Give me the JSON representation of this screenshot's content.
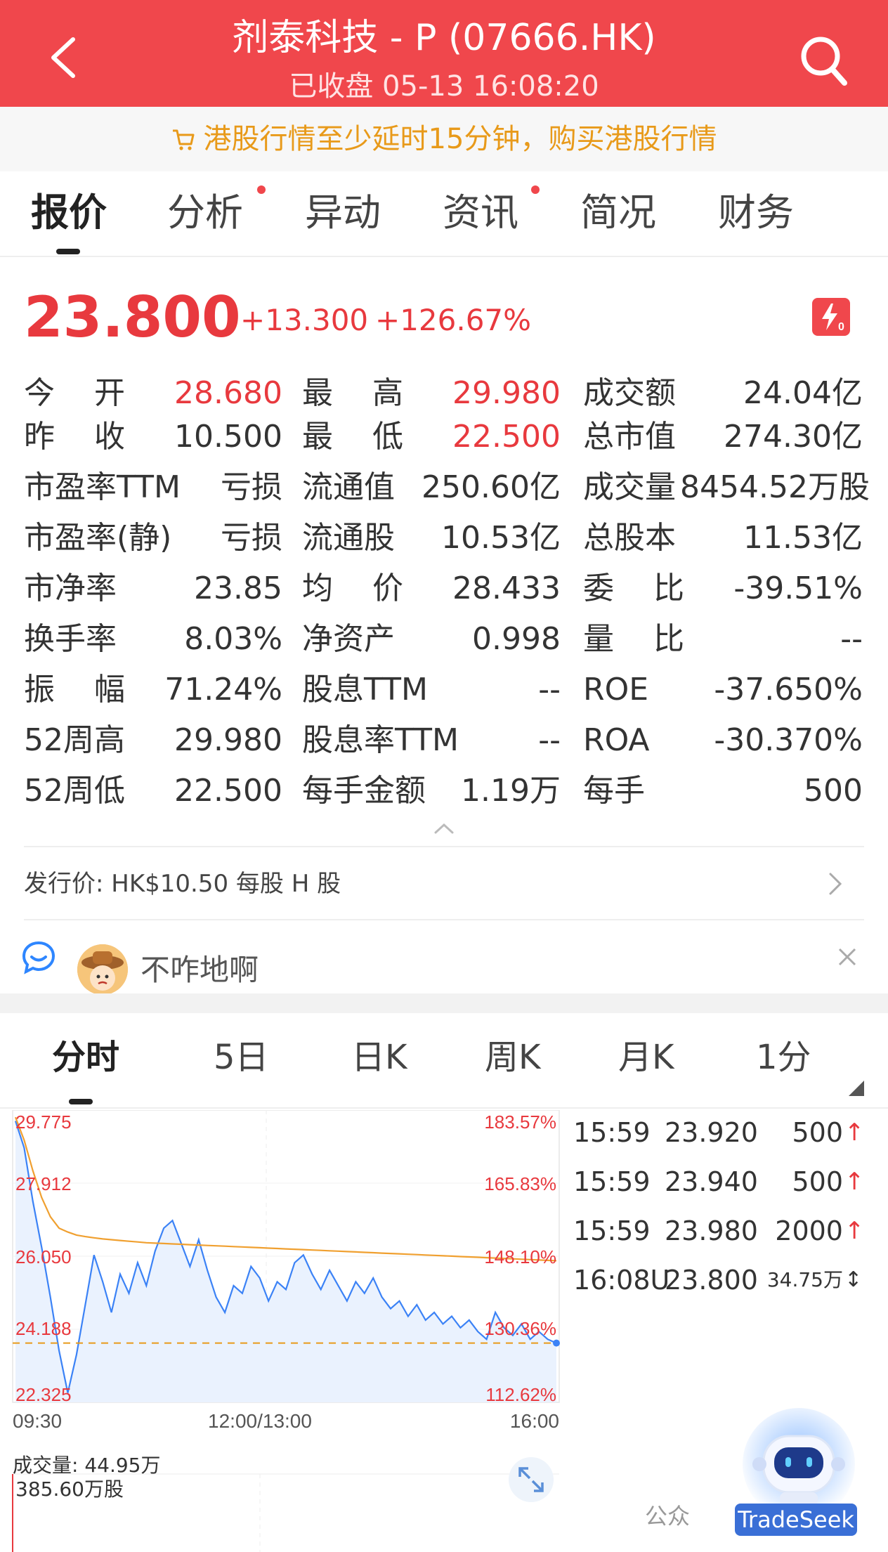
{
  "header": {
    "title": "剂泰科技 - P (07666.HK)",
    "subtitle": "已收盘  05-13  16:08:20",
    "back_icon": "chevron-left-icon",
    "search_icon": "search-icon",
    "bg_color": "#f0474c"
  },
  "notice": {
    "text": "港股行情至少延时15分钟，购买港股行情",
    "icon": "cart-icon",
    "color": "#e89a1a"
  },
  "tabs": [
    {
      "label": "报价",
      "active": true,
      "dot": false
    },
    {
      "label": "分析",
      "active": false,
      "dot": true
    },
    {
      "label": "异动",
      "active": false,
      "dot": false
    },
    {
      "label": "资讯",
      "active": false,
      "dot": true
    },
    {
      "label": "简况",
      "active": false,
      "dot": false
    },
    {
      "label": "财务",
      "active": false,
      "dot": false
    }
  ],
  "quote": {
    "price": "23.800",
    "change": "+13.300",
    "change_pct": "+126.67%",
    "up_color": "#e8393e"
  },
  "stats": {
    "col1": [
      {
        "label": "今    开",
        "value": "28.680",
        "red": true
      },
      {
        "label": "昨    收",
        "value": "10.500",
        "red": false
      },
      {
        "label": "市盈率TTM",
        "value": "亏损",
        "red": false
      },
      {
        "label": "市盈率(静)",
        "value": "亏损",
        "red": false
      },
      {
        "label": "市净率",
        "value": "23.85",
        "red": false
      },
      {
        "label": "换手率",
        "value": "8.03%",
        "red": false
      },
      {
        "label": "振    幅",
        "value": "71.24%",
        "red": false
      },
      {
        "label": "52周高",
        "value": "29.980",
        "red": false
      },
      {
        "label": "52周低",
        "value": "22.500",
        "red": false
      }
    ],
    "col2": [
      {
        "label": "最    高",
        "value": "29.980",
        "red": true
      },
      {
        "label": "最    低",
        "value": "22.500",
        "red": true
      },
      {
        "label": "流通值",
        "value": "250.60亿",
        "red": false
      },
      {
        "label": "流通股",
        "value": "10.53亿",
        "red": false
      },
      {
        "label": "均    价",
        "value": "28.433",
        "red": false
      },
      {
        "label": "净资产",
        "value": "0.998",
        "red": false
      },
      {
        "label": "股息TTM",
        "value": "--",
        "red": false
      },
      {
        "label": "股息率TTM",
        "value": "--",
        "red": false
      },
      {
        "label": "每手金额",
        "value": "1.19万",
        "red": false
      }
    ],
    "col3": [
      {
        "label": "成交额",
        "value": "24.04亿",
        "red": false
      },
      {
        "label": "总市值",
        "value": "274.30亿",
        "red": false
      },
      {
        "label": "成交量",
        "value": "8454.52万股",
        "red": false
      },
      {
        "label": "总股本",
        "value": "11.53亿",
        "red": false
      },
      {
        "label": "委    比",
        "value": "-39.51%",
        "red": false
      },
      {
        "label": "量    比",
        "value": "--",
        "red": false
      },
      {
        "label": "ROE",
        "value": "-37.650%",
        "red": false
      },
      {
        "label": "ROA",
        "value": "-30.370%",
        "red": false
      },
      {
        "label": "每手",
        "value": "500",
        "red": false
      }
    ]
  },
  "issue": {
    "text": "发行价: HK$10.50 每股 H 股"
  },
  "comment": {
    "user_text": "不咋地啊",
    "chat_icon": "chat-bubble-icon",
    "avatar": "cowboy-avatar",
    "close_icon": "close-icon"
  },
  "chart_tabs": [
    {
      "label": "分时",
      "active": true
    },
    {
      "label": "5日",
      "active": false
    },
    {
      "label": "日K",
      "active": false
    },
    {
      "label": "周K",
      "active": false
    },
    {
      "label": "月K",
      "active": false
    },
    {
      "label": "1分",
      "active": false
    }
  ],
  "chart_data": {
    "type": "line",
    "y_labels_left": [
      "29.775",
      "27.912",
      "26.050",
      "24.188",
      "22.325"
    ],
    "y_labels_right": [
      "183.57%",
      "165.83%",
      "148.10%",
      "130.36%",
      "112.62%"
    ],
    "x_labels": [
      "09:30",
      "12:00/13:00",
      "16:00"
    ],
    "ylim": [
      22.325,
      29.775
    ],
    "reference_price": 23.8,
    "series": [
      {
        "values": [
          29.6,
          28.9,
          27.5,
          26.3,
          25.0,
          23.6,
          22.5,
          23.5,
          24.8,
          26.1,
          25.4,
          24.6,
          25.6,
          25.1,
          25.9,
          25.3,
          26.2,
          26.8,
          27.0,
          26.4,
          25.8,
          26.5,
          25.7,
          25.0,
          24.6,
          25.3,
          25.1,
          25.8,
          25.5,
          24.9,
          25.4,
          25.2,
          25.9,
          26.1,
          25.6,
          25.2,
          25.7,
          25.3,
          24.9,
          25.4,
          25.1,
          25.5,
          25.0,
          24.7,
          24.9,
          24.5,
          24.8,
          24.4,
          24.6,
          24.3,
          24.5,
          24.2,
          24.4,
          24.1,
          23.9,
          24.6,
          24.2,
          24.0,
          24.3,
          23.9,
          24.1,
          23.9,
          23.8
        ],
        "color": "#3b82f6"
      },
      {
        "values": [
          29.7,
          29.1,
          28.3,
          27.6,
          27.1,
          26.8,
          26.7,
          26.62,
          26.58,
          26.55,
          26.52,
          26.5,
          26.48,
          26.46,
          26.44,
          26.42,
          26.41,
          26.4,
          26.39,
          26.38,
          26.37,
          26.36,
          26.35,
          26.34,
          26.33,
          26.32,
          26.31,
          26.3,
          26.29,
          26.28,
          26.27,
          26.26,
          26.25,
          26.24,
          26.23,
          26.22,
          26.21,
          26.2,
          26.19,
          26.18,
          26.17,
          26.16,
          26.15,
          26.14,
          26.13,
          26.12,
          26.11,
          26.1,
          26.09,
          26.08,
          26.07,
          26.06,
          26.05,
          26.04,
          26.03,
          26.02,
          26.01,
          26.0,
          25.99,
          25.98,
          25.97,
          25.96,
          25.95
        ],
        "color": "#f0a030"
      }
    ]
  },
  "trades": [
    {
      "time": "15:59",
      "price": "23.920",
      "vol": "500",
      "dir": "↑"
    },
    {
      "time": "15:59",
      "price": "23.940",
      "vol": "500",
      "dir": "↑"
    },
    {
      "time": "15:59",
      "price": "23.980",
      "vol": "2000",
      "dir": "↑"
    },
    {
      "time": "16:08U",
      "price": "23.800",
      "vol": "34.75万",
      "dir": "↕"
    }
  ],
  "volume": {
    "label": "成交量: 44.95万",
    "total": "385.60万股"
  },
  "watermark": {
    "text": "公众",
    "brand": "TradeSeek"
  }
}
